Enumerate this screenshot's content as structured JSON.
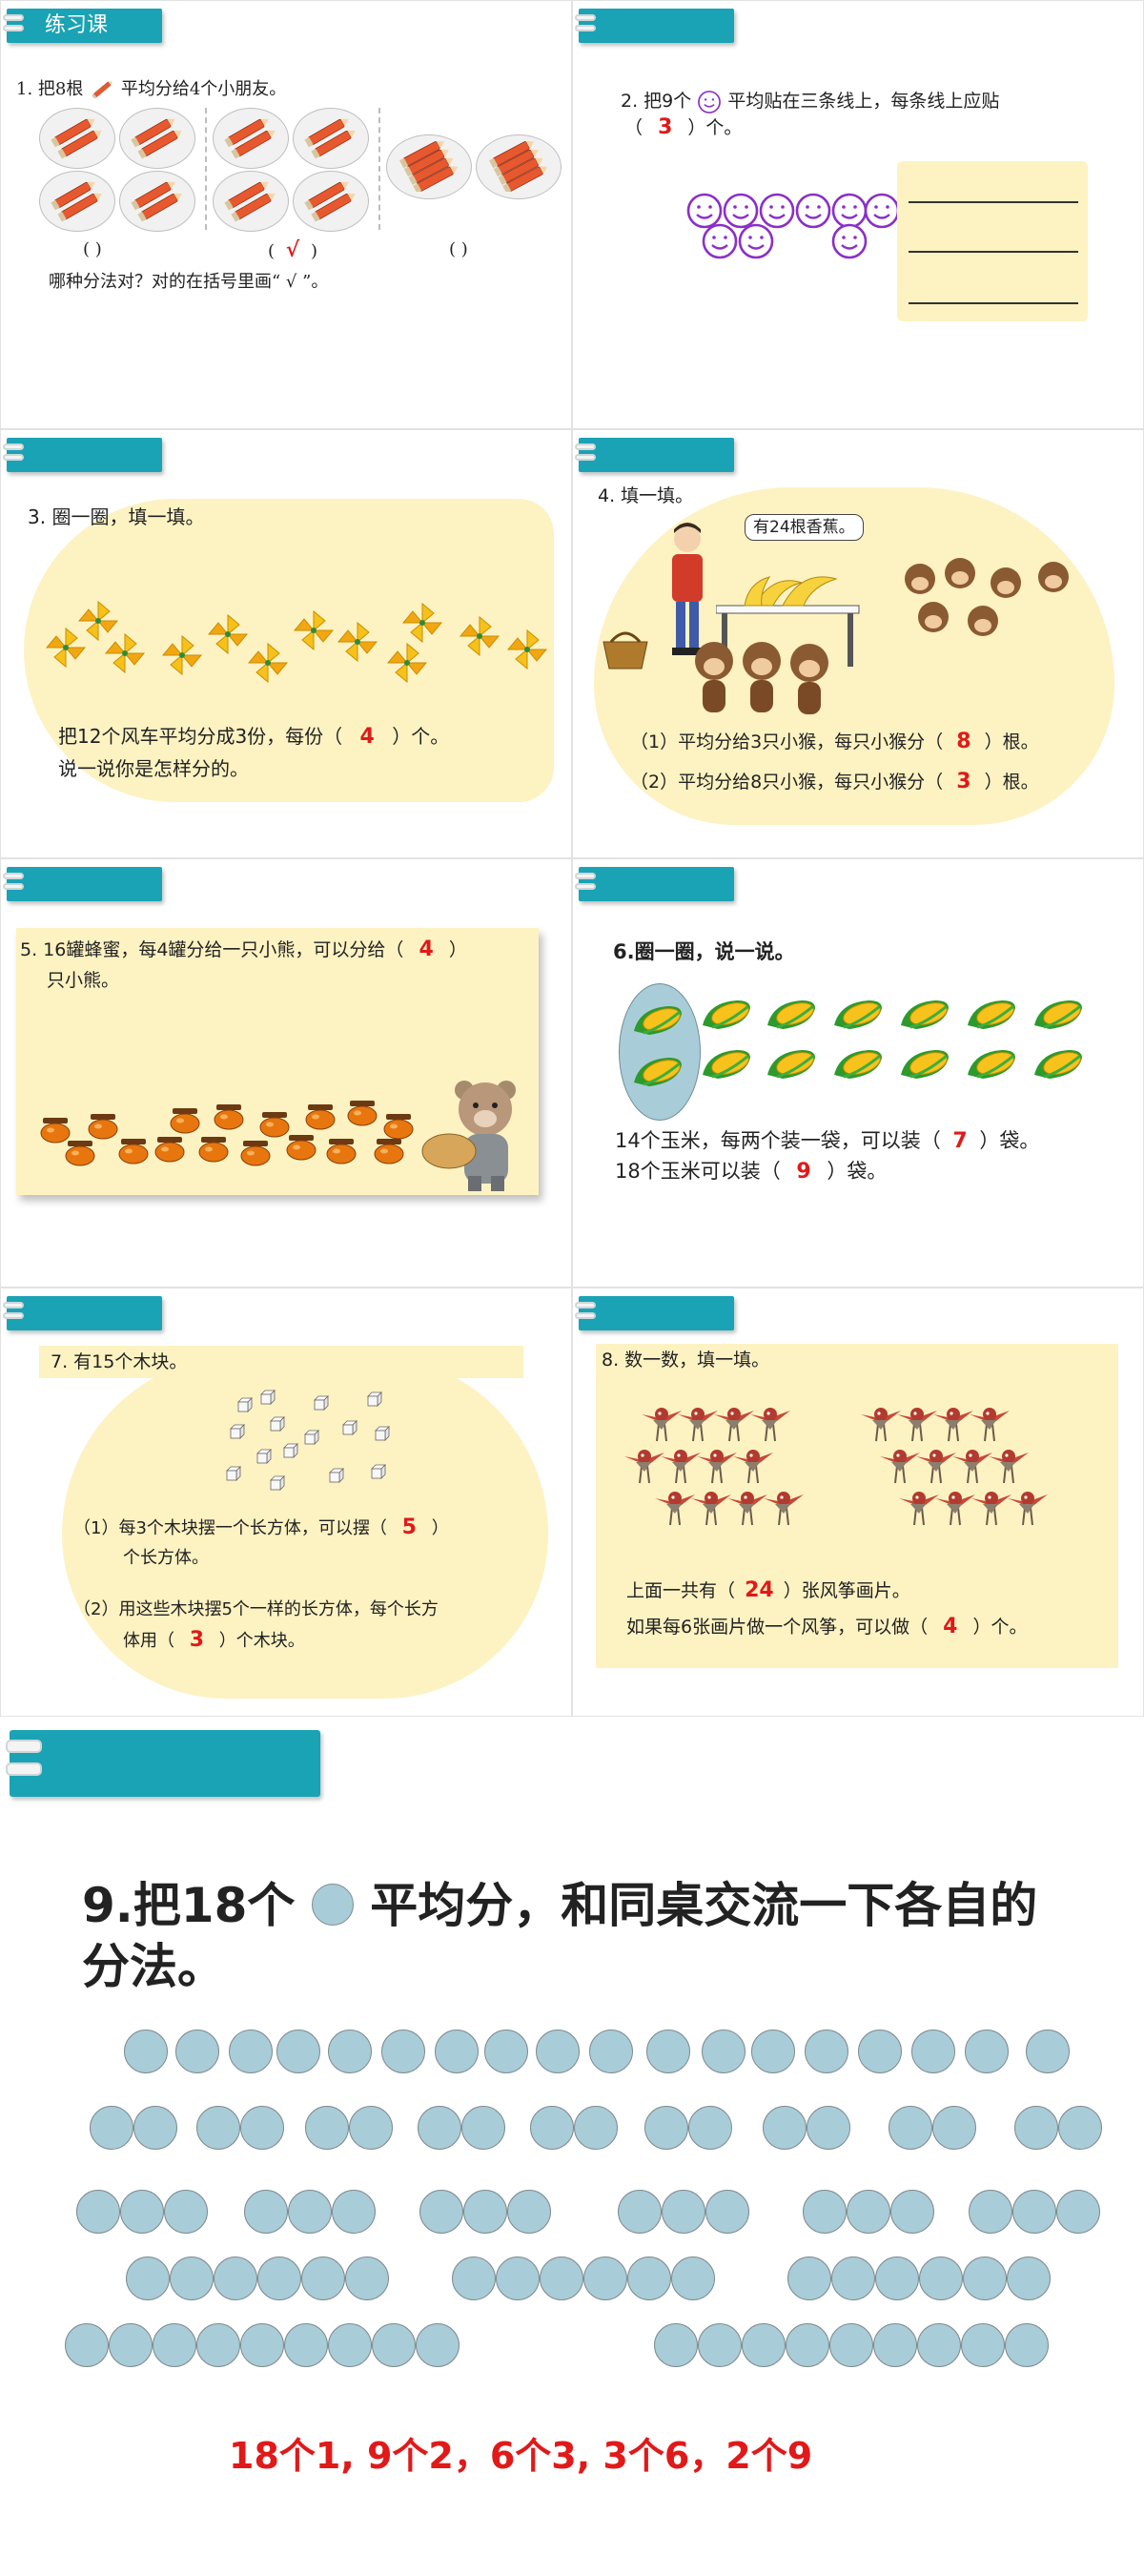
{
  "panels": {
    "p1": {
      "tab": "练习课",
      "q_prefix": "1.  把8根",
      "q_suffix": "平均分给4个小朋友。",
      "choice_a": "(      )",
      "choice_b_open": "(",
      "choice_b_mark": "√",
      "choice_b_close": ")",
      "choice_c": "(      )",
      "instruction": "哪种分法对？对的在括号里画“ √ ”。"
    },
    "p2": {
      "q_prefix": "2. 把9个",
      "q_suffix": "平均贴在三条线上，每条线上应贴",
      "line2_open": "（",
      "answer": "3",
      "line2_close": "）个。"
    },
    "p3": {
      "title": "3. 圈一圈，填一填。",
      "line1_a": "把12个风车平均分成3份，每份（",
      "answer": "4",
      "line1_b": "）个。",
      "line2": "说一说你是怎样分的。"
    },
    "p4": {
      "title": "4. 填一填。",
      "speech": "有24根香蕉。",
      "q1_a": "（1）平均分给3只小猴，每只小猴分（",
      "q1_ans": "8",
      "q1_b": "）根。",
      "q2_a": "（2）平均分给8只小猴，每只小猴分（",
      "q2_ans": "3",
      "q2_b": "）根。"
    },
    "p5": {
      "line1_a": "5. 16罐蜂蜜，每4罐分给一只小熊，可以分给（",
      "answer": "4",
      "line1_b": "）",
      "line2": "只小熊。"
    },
    "p6": {
      "title": "6.圈一圈，说一说。",
      "line1_a": "14个玉米，每两个装一袋，可以装（",
      "ans1": "7",
      "line1_b": "）袋。",
      "line2_a": "18个玉米可以装（",
      "ans2": "9",
      "line2_b": "）袋。"
    },
    "p7": {
      "title": "7. 有15个木块。",
      "q1_a": "（1）每3个木块摆一个长方体，可以摆（",
      "q1_ans": "5",
      "q1_b": "）",
      "q1_c": "个长方体。",
      "q2_a": "（2）用这些木块摆5个一样的长方体，每个长方",
      "q2_b": "体用（",
      "q2_ans": "3",
      "q2_c": "）个木块。"
    },
    "p8": {
      "title": "8. 数一数，填一填。",
      "line1_a": "上面一共有（",
      "ans1": "24",
      "line1_b": "）张风筝画片。",
      "line2_a": "如果每6张画片做一个风筝，可以做（",
      "ans2": "4",
      "line2_b": "）个。"
    },
    "p9": {
      "title_a": "9.把18个",
      "title_b": "平均分，和同桌交流一下各自的",
      "title_c": "分法。",
      "answer": "18个1, 9个2，6个3, 3个6，2个9"
    }
  },
  "colors": {
    "tab": "#1aa3b5",
    "answer": "#e11919",
    "blob": "#fdf2c2",
    "circle": "#a9cdd8"
  },
  "icons": [
    "ring-binder-icon",
    "pencil-icon",
    "smiley-icon",
    "pinwheel-icon",
    "honey-jar-icon",
    "corn-icon",
    "wood-block-icon",
    "kite-bird-icon",
    "circle-icon"
  ]
}
